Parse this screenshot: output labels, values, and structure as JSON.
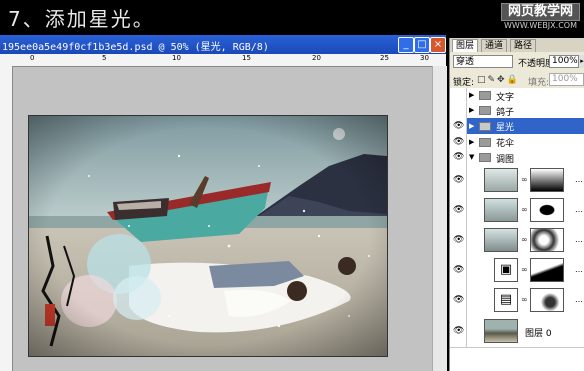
{
  "banner": {
    "step_title": "7、添加星光。",
    "watermark_top": "网页教学网",
    "watermark_bottom": "WWW.WEBJX.COM"
  },
  "document": {
    "title": "195ee0a5e49f0cf1b3e5d.psd @ 50% (星光, RGB/8)",
    "buttons": {
      "minimize": "_",
      "maximize": "□",
      "close": "×"
    },
    "ruler_labels": [
      "0",
      "5",
      "10",
      "15",
      "20",
      "25",
      "30"
    ]
  },
  "layers_panel": {
    "tabs": [
      "图层",
      "通道",
      "路径"
    ],
    "blend_mode": "穿透",
    "opacity_label": "不透明度:",
    "opacity_value": "100%",
    "lock_label": "锁定:",
    "fill_label": "填充:",
    "fill_value": "100%",
    "layers": [
      {
        "name": "文字",
        "type": "group",
        "visible": false
      },
      {
        "name": "鸽子",
        "type": "group",
        "visible": false
      },
      {
        "name": "星光",
        "type": "group",
        "visible": true,
        "selected": true
      },
      {
        "name": "花伞",
        "type": "group",
        "visible": true
      },
      {
        "name": "调图",
        "type": "group",
        "visible": true,
        "expanded": true
      },
      {
        "name": "",
        "type": "adjustment",
        "visible": true
      },
      {
        "name": "",
        "type": "adjustment",
        "visible": true
      },
      {
        "name": "",
        "type": "adjustment",
        "visible": true
      },
      {
        "name": "",
        "type": "adjustment",
        "visible": true
      },
      {
        "name": "",
        "type": "adjustment",
        "visible": true
      },
      {
        "name": "图层 0",
        "type": "image",
        "visible": true
      }
    ]
  },
  "colors": {
    "accent": "#3064c8",
    "titlebar": "#2a62d8"
  },
  "icons": [
    "eye-icon",
    "folder-icon",
    "chain-icon",
    "lock-icon"
  ]
}
